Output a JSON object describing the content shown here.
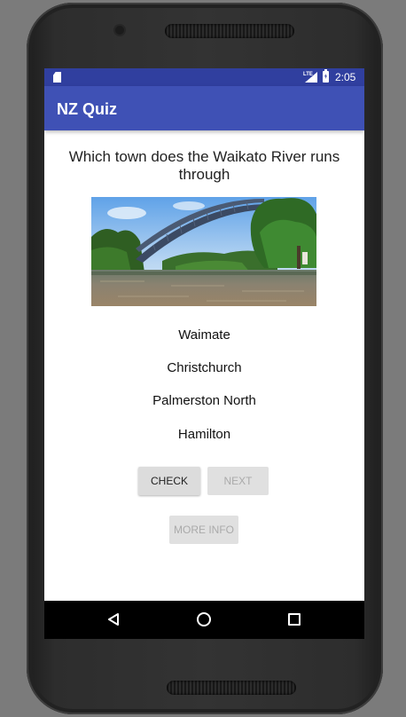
{
  "status_bar": {
    "network": "LTE",
    "time": "2:05"
  },
  "app_bar": {
    "title": "NZ Quiz"
  },
  "quiz": {
    "question": "Which town does the Waikato River runs through",
    "answers": [
      "Waimate",
      "Christchurch",
      "Palmerston North",
      "Hamilton"
    ],
    "check_label": "CHECK",
    "next_label": "NEXT",
    "more_info_label": "MORE INFO"
  },
  "icons": {
    "sd_card": "sd-card-icon",
    "signal": "signal-icon",
    "battery": "battery-charging-icon",
    "back": "back-icon",
    "home": "home-icon",
    "recents": "recents-icon"
  },
  "colors": {
    "status_bar": "#303f9f",
    "app_bar": "#3f51b5",
    "button": "#dcdcdc",
    "disabled_text": "#aaaaaa"
  }
}
